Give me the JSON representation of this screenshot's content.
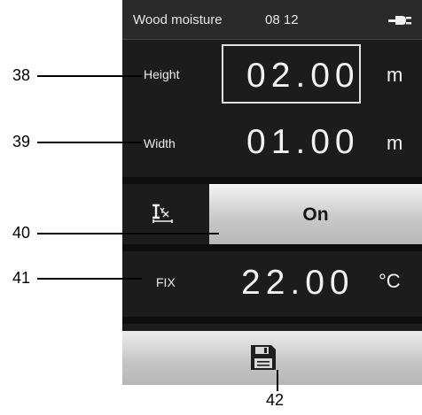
{
  "status": {
    "title": "Wood moisture",
    "time": "08 12"
  },
  "rows": [
    {
      "label": "Height",
      "value": "02.00",
      "unit": "m"
    },
    {
      "label": "Width",
      "value": "01.00",
      "unit": "m"
    },
    {
      "label": "FIX",
      "value": "22.00",
      "unit": "°C"
    }
  ],
  "toggle": {
    "label": "On"
  },
  "callouts": [
    "38",
    "39",
    "40",
    "41",
    "42"
  ],
  "icons": {
    "status": "power-plug-icon",
    "toggle_row": "dimension-measure-icon",
    "bottom": "save-floppy-icon"
  },
  "colors": {
    "screen": "#1c1c1c",
    "button": "#c9c9c9",
    "text": "#f2f2f2"
  }
}
